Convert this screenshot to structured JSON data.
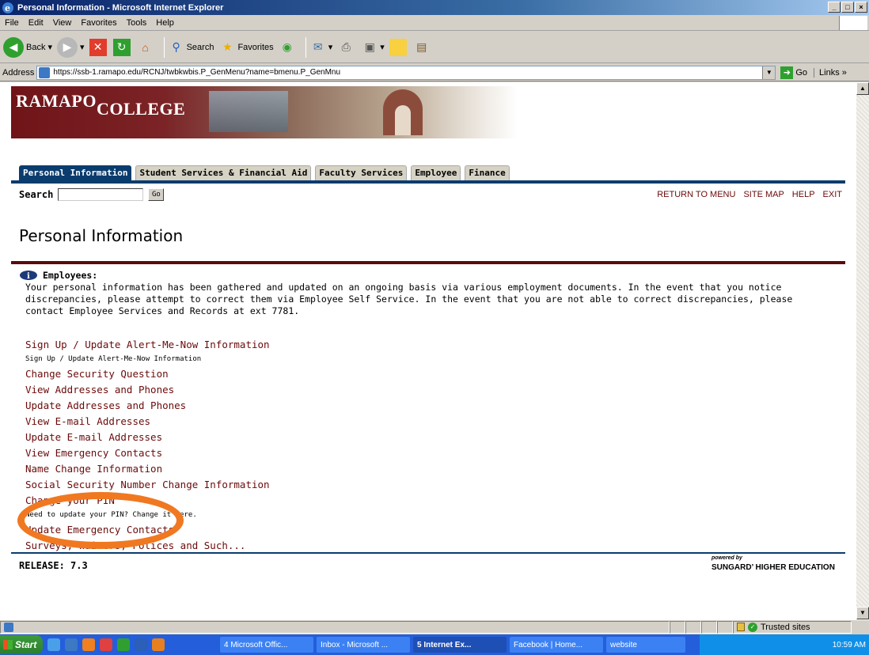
{
  "window": {
    "title": "Personal Information - Microsoft Internet Explorer"
  },
  "menubar": [
    "File",
    "Edit",
    "View",
    "Favorites",
    "Tools",
    "Help"
  ],
  "toolbar": {
    "back": "Back",
    "search": "Search",
    "favorites": "Favorites"
  },
  "address": {
    "label": "Address",
    "url": "https://ssb-1.ramapo.edu/RCNJ/twbkwbis.P_GenMenu?name=bmenu.P_GenMnu",
    "go": "Go",
    "links": "Links"
  },
  "banner": {
    "logo_part1": "RAMAPO",
    "logo_part2": "COLLEGE"
  },
  "tabs": [
    "Personal Information",
    "Student Services & Financial Aid",
    "Faculty Services",
    "Employee",
    "Finance"
  ],
  "search": {
    "label": "Search",
    "go": "Go"
  },
  "toplinks": [
    "RETURN TO MENU",
    "SITE MAP",
    "HELP",
    "EXIT"
  ],
  "page_title": "Personal Information",
  "info": {
    "heading": "Employees:",
    "body": "Your personal information has been gathered and updated on an ongoing basis via various employment documents. In the event that you notice discrepancies, please attempt to correct them via Employee Self Service. In the event that you are not able to correct discrepancies, please contact Employee Services and Records at ext 7781."
  },
  "menu": [
    {
      "type": "link",
      "text": "Sign Up / Update Alert-Me-Now Information"
    },
    {
      "type": "desc",
      "text": "Sign Up / Update Alert-Me-Now Information"
    },
    {
      "type": "link",
      "text": "Change Security Question"
    },
    {
      "type": "link",
      "text": "View Addresses and Phones"
    },
    {
      "type": "link",
      "text": "Update Addresses and Phones"
    },
    {
      "type": "link",
      "text": "View E-mail Addresses"
    },
    {
      "type": "link",
      "text": "Update E-mail Addresses"
    },
    {
      "type": "link",
      "text": "View Emergency Contacts"
    },
    {
      "type": "link",
      "text": "Name Change Information"
    },
    {
      "type": "link",
      "text": "Social Security Number Change Information"
    },
    {
      "type": "link",
      "text": "Change your PIN"
    },
    {
      "type": "desc",
      "text": "Need to update your PIN? Change it here."
    },
    {
      "type": "link",
      "text": "Update Emergency Contacts"
    },
    {
      "type": "link",
      "text": "Surveys, Waivers, Polices and Such..."
    }
  ],
  "release": "RELEASE: 7.3",
  "powered": {
    "line1": "powered by",
    "line2": "SUNGARD’ HIGHER EDUCATION"
  },
  "status": {
    "zone": "Trusted sites"
  },
  "taskbar": {
    "start": "Start",
    "tasks": [
      "4 Microsoft Offic...",
      "Inbox - Microsoft ...",
      "5 Internet Ex...",
      "Facebook | Home...",
      "website"
    ],
    "clock": "10:59 AM"
  },
  "colors": {
    "nav_blue": "#0b3c6e",
    "link_maroon": "#6b0a0a",
    "divider_maroon": "#5a0a0e",
    "highlight_orange": "#f07820"
  }
}
